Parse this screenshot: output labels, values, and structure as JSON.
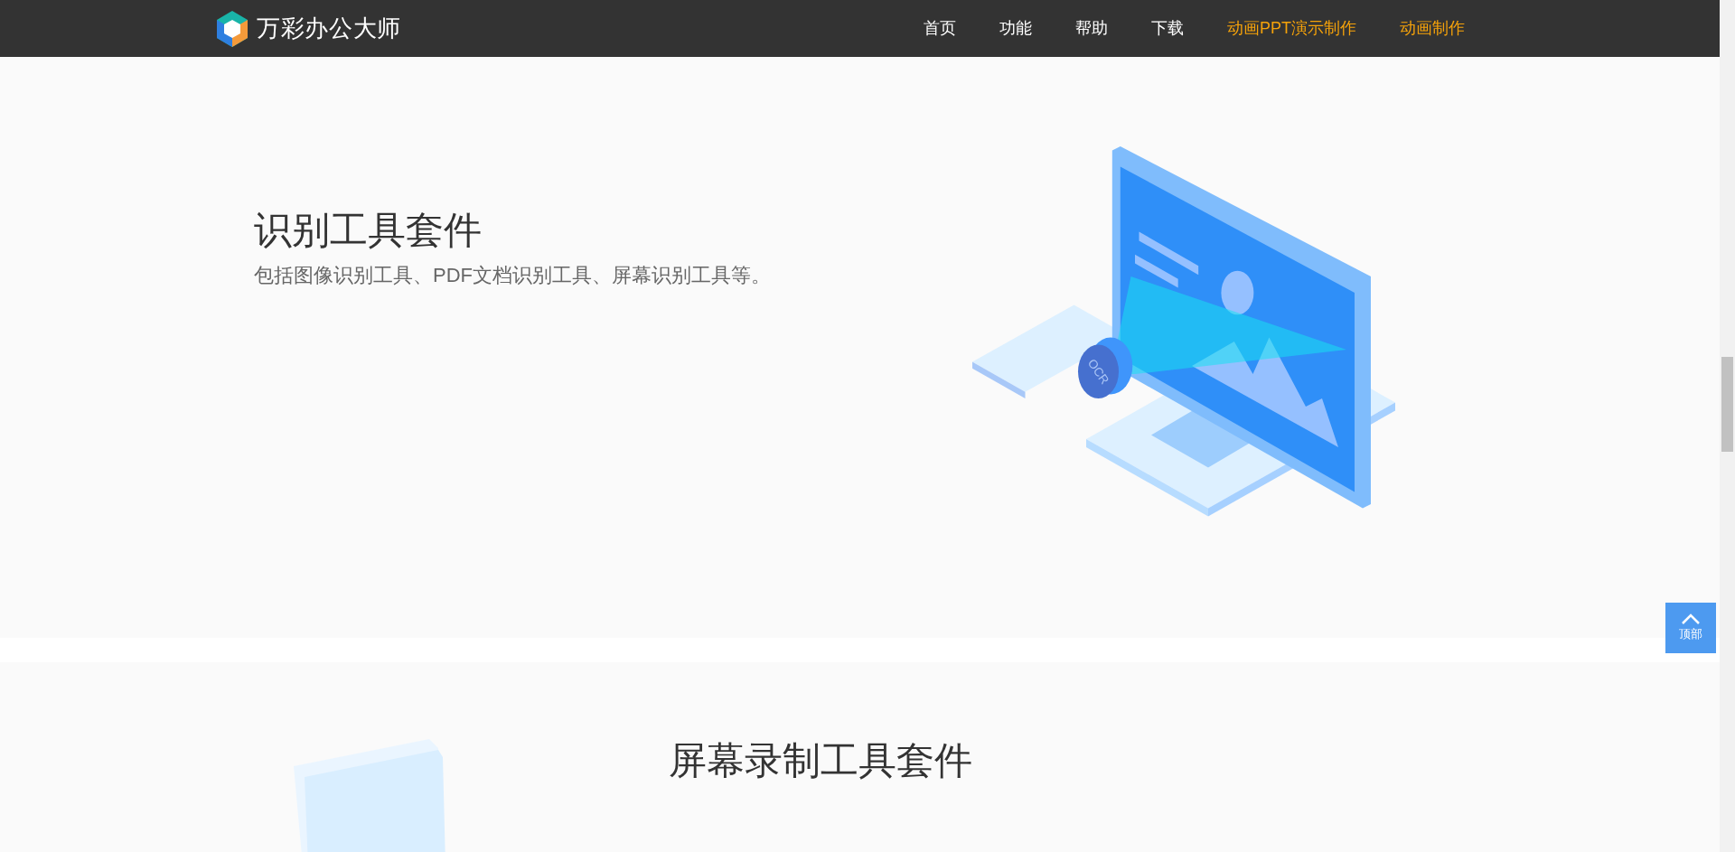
{
  "header": {
    "logo_text": "万彩办公大师",
    "nav": [
      {
        "label": "首页",
        "kind": "normal"
      },
      {
        "label": "功能",
        "kind": "normal"
      },
      {
        "label": "帮助",
        "kind": "normal"
      },
      {
        "label": "下载",
        "kind": "normal"
      },
      {
        "label": "动画PPT演示制作",
        "kind": "highlight"
      },
      {
        "label": "动画制作",
        "kind": "highlight"
      }
    ]
  },
  "sections": [
    {
      "title": "识别工具套件",
      "description": "包括图像识别工具、PDF文档识别工具、屏幕识别工具等。",
      "badge": "OCR"
    },
    {
      "title": "屏幕录制工具套件"
    }
  ],
  "back_to_top": {
    "label": "顶部"
  }
}
